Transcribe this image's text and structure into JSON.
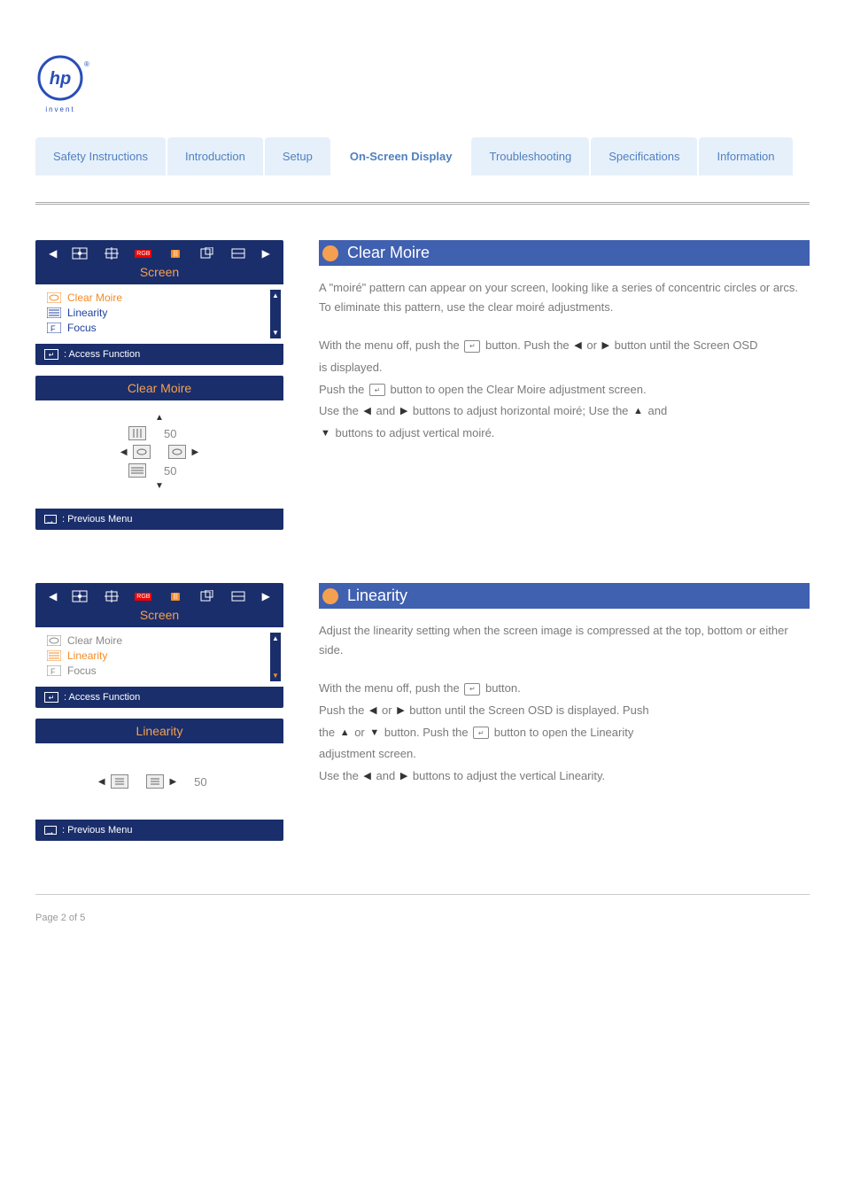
{
  "logo_alt": "hp invent",
  "tabs": [
    "Safety Instructions",
    "Introduction",
    "Setup",
    "On-Screen Display",
    "Troubleshooting",
    "Specifications",
    "Information"
  ],
  "active_tab_index": 3,
  "sections": [
    {
      "title": "Clear Moire",
      "desc": "A \"moiré\" pattern can appear on your screen, looking like a series of concentric circles or arcs. To eliminate this pattern, use the clear moiré adjustments.",
      "steps": {
        "line1_prefix": "With the menu off, push the ",
        "line1_mid": " button. Push the ",
        "line1_or": " or ",
        "line1_suffix": " button until the Screen OSD",
        "line2_prefix": "is displayed.",
        "line3_prefix": "Push the ",
        "line3_mid": " button to open the Clear Moire adjustment screen.",
        "line4_prefix": "Use the ",
        "line4_mid": " and ",
        "line4_suffix1": " buttons to adjust horizontal moiré; Use the ",
        "line4_and": " and ",
        "line5_suffix": " buttons to adjust vertical moiré."
      },
      "osd_main": {
        "title": "Screen",
        "items": [
          {
            "label": "Clear Moire",
            "sel": true
          },
          {
            "label": "Linearity",
            "sel": false
          },
          {
            "label": "Focus",
            "sel": false
          }
        ],
        "foot": ": Access Function"
      },
      "osd_sub": {
        "title": "Clear Moire",
        "val1": "50",
        "val2": "50",
        "foot": ": Previous Menu"
      }
    },
    {
      "title": "Linearity",
      "desc": "Adjust the linearity setting when the screen image is compressed at the top, bottom or either side.",
      "steps": {
        "line1_prefix": "With the menu off, push the ",
        "line1_suffix": " button.",
        "line2_prefix": "Push the ",
        "line2_or": " or ",
        "line2_suffix": " button until the Screen OSD is displayed. Push",
        "line3_prefix": "the ",
        "line3_or": " or ",
        "line3_mid": " button. Push the ",
        "line3_suffix": " button to open the Linearity",
        "line4": "adjustment screen.",
        "line5_prefix": "Use the ",
        "line5_and": " and ",
        "line5_suffix": " buttons to adjust the vertical Linearity."
      },
      "osd_main": {
        "title": "Screen",
        "items": [
          {
            "label": "Clear Moire",
            "sel": false,
            "grey": true
          },
          {
            "label": "Linearity",
            "sel": true
          },
          {
            "label": "Focus",
            "sel": false,
            "grey": true
          }
        ],
        "foot": ": Access Function"
      },
      "osd_sub": {
        "title": "Linearity",
        "val1": "50",
        "foot": ": Previous Menu"
      }
    }
  ],
  "page_number": "Page 2 of 5"
}
